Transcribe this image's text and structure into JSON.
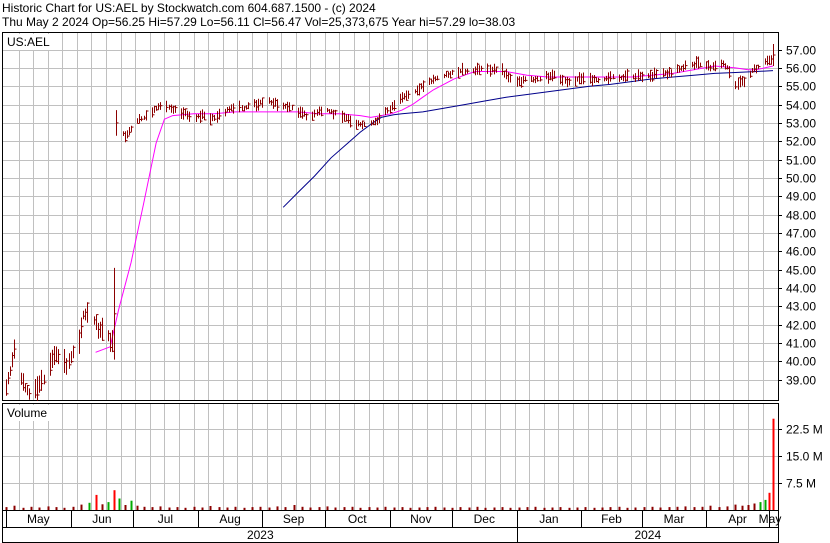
{
  "header": {
    "line1": "Historic Chart for US:AEL by Stockwatch.com 604.687.1500 - (c) 2024",
    "line2": "Thu May  2 2024  Op=56.25  Hi=57.29  Lo=56.11  Cl=56.47  Vol=25,373,675  Year hi=57.29  lo=38.03"
  },
  "chart_data": [
    {
      "type": "line",
      "title": "US:AEL",
      "ylim": [
        37.9,
        57.9
      ],
      "y_ticks": [
        "39.00",
        "40.00",
        "41.00",
        "42.00",
        "43.00",
        "44.00",
        "45.00",
        "46.00",
        "47.00",
        "48.00",
        "49.00",
        "50.00",
        "51.00",
        "52.00",
        "53.00",
        "54.00",
        "55.00",
        "56.00",
        "57.00"
      ],
      "x_month_labels": [
        "May",
        "Jun",
        "Jul",
        "Aug",
        "Sep",
        "Oct",
        "Nov",
        "Dec",
        "Jan",
        "Feb",
        "Mar",
        "Apr",
        "May"
      ],
      "x_year_labels": [
        "2023",
        "2024"
      ],
      "x_range_days": [
        0,
        368
      ],
      "grid": true,
      "colors": {
        "bars": "#8b0000",
        "ma_short": "#ff00ff",
        "ma_long": "#00008b",
        "grid": "#c0c0c0"
      },
      "price_path": [
        [
          0,
          38.6
        ],
        [
          4,
          40.5
        ],
        [
          7,
          39.1
        ],
        [
          11,
          38.2
        ],
        [
          15,
          38.5
        ],
        [
          19,
          39.3
        ],
        [
          22,
          40.1
        ],
        [
          26,
          40.4
        ],
        [
          29,
          39.7
        ],
        [
          32,
          40.6
        ],
        [
          35,
          41.3
        ],
        [
          37,
          42.5
        ],
        [
          40,
          42.6
        ],
        [
          42,
          42.2
        ],
        [
          45,
          41.6
        ],
        [
          48,
          41.7
        ],
        [
          50,
          41.2
        ],
        [
          52,
          40.7
        ],
        [
          53,
          52.9
        ],
        [
          55,
          52.4
        ],
        [
          58,
          52.3
        ],
        [
          62,
          53.0
        ],
        [
          66,
          53.3
        ],
        [
          70,
          53.6
        ],
        [
          74,
          53.9
        ],
        [
          78,
          53.9
        ],
        [
          82,
          53.7
        ],
        [
          86,
          53.5
        ],
        [
          90,
          53.3
        ],
        [
          94,
          53.4
        ],
        [
          98,
          53.2
        ],
        [
          102,
          53.4
        ],
        [
          106,
          53.7
        ],
        [
          110,
          53.8
        ],
        [
          114,
          53.8
        ],
        [
          118,
          54.0
        ],
        [
          122,
          54.1
        ],
        [
          126,
          54.2
        ],
        [
          130,
          54.0
        ],
        [
          134,
          53.9
        ],
        [
          138,
          53.8
        ],
        [
          142,
          53.5
        ],
        [
          146,
          53.3
        ],
        [
          150,
          53.6
        ],
        [
          154,
          53.7
        ],
        [
          158,
          53.5
        ],
        [
          162,
          53.4
        ],
        [
          166,
          53.0
        ],
        [
          170,
          52.9
        ],
        [
          174,
          52.9
        ],
        [
          178,
          53.1
        ],
        [
          182,
          53.6
        ],
        [
          186,
          54.0
        ],
        [
          190,
          54.3
        ],
        [
          194,
          54.6
        ],
        [
          198,
          54.9
        ],
        [
          202,
          55.2
        ],
        [
          206,
          55.4
        ],
        [
          210,
          55.6
        ],
        [
          214,
          55.7
        ],
        [
          218,
          55.8
        ],
        [
          222,
          55.8
        ],
        [
          226,
          55.9
        ],
        [
          230,
          56.0
        ],
        [
          234,
          55.9
        ],
        [
          238,
          55.8
        ],
        [
          242,
          55.4
        ],
        [
          246,
          55.3
        ],
        [
          250,
          55.4
        ],
        [
          254,
          55.3
        ],
        [
          258,
          55.5
        ],
        [
          262,
          55.6
        ],
        [
          266,
          55.4
        ],
        [
          270,
          55.3
        ],
        [
          274,
          55.4
        ],
        [
          278,
          55.3
        ],
        [
          282,
          55.4
        ],
        [
          286,
          55.3
        ],
        [
          290,
          55.5
        ],
        [
          294,
          55.4
        ],
        [
          298,
          55.5
        ],
        [
          302,
          55.5
        ],
        [
          306,
          55.6
        ],
        [
          310,
          55.6
        ],
        [
          314,
          55.7
        ],
        [
          318,
          55.7
        ],
        [
          322,
          55.9
        ],
        [
          326,
          56.1
        ],
        [
          330,
          56.2
        ],
        [
          334,
          56.2
        ],
        [
          338,
          56.0
        ],
        [
          340,
          56.1
        ],
        [
          342,
          56.3
        ],
        [
          344,
          56.2
        ],
        [
          346,
          56.0
        ],
        [
          348,
          55.5
        ],
        [
          350,
          55.1
        ],
        [
          353,
          55.2
        ],
        [
          356,
          55.4
        ],
        [
          358,
          55.9
        ],
        [
          360,
          56.0
        ],
        [
          362,
          56.1
        ],
        [
          364,
          56.3
        ],
        [
          366,
          56.5
        ],
        [
          368,
          56.5
        ]
      ],
      "special_bars": [
        {
          "x": 52,
          "low": 40.1,
          "high": 45.1
        },
        {
          "x": 53,
          "low": 52.3,
          "high": 53.7
        },
        {
          "x": 368,
          "low": 56.1,
          "high": 57.3
        }
      ],
      "ma_short": [
        [
          43,
          40.5
        ],
        [
          50,
          40.8
        ],
        [
          54,
          42.8
        ],
        [
          60,
          45.4
        ],
        [
          66,
          48.6
        ],
        [
          72,
          51.9
        ],
        [
          76,
          53.2
        ],
        [
          80,
          53.4
        ],
        [
          90,
          53.5
        ],
        [
          100,
          53.5
        ],
        [
          110,
          53.6
        ],
        [
          120,
          53.6
        ],
        [
          130,
          53.6
        ],
        [
          140,
          53.6
        ],
        [
          150,
          53.5
        ],
        [
          160,
          53.5
        ],
        [
          170,
          53.4
        ],
        [
          175,
          53.3
        ],
        [
          180,
          53.4
        ],
        [
          185,
          53.5
        ],
        [
          190,
          53.7
        ],
        [
          195,
          54.0
        ],
        [
          200,
          54.4
        ],
        [
          205,
          54.8
        ],
        [
          210,
          55.1
        ],
        [
          215,
          55.4
        ],
        [
          220,
          55.6
        ],
        [
          225,
          55.8
        ],
        [
          230,
          55.8
        ],
        [
          235,
          55.8
        ],
        [
          240,
          55.8
        ],
        [
          245,
          55.7
        ],
        [
          250,
          55.6
        ],
        [
          260,
          55.5
        ],
        [
          270,
          55.5
        ],
        [
          280,
          55.5
        ],
        [
          290,
          55.5
        ],
        [
          300,
          55.5
        ],
        [
          310,
          55.6
        ],
        [
          320,
          55.7
        ],
        [
          330,
          55.9
        ],
        [
          340,
          56.1
        ],
        [
          350,
          56.0
        ],
        [
          356,
          55.9
        ],
        [
          360,
          55.9
        ],
        [
          364,
          56.0
        ],
        [
          368,
          56.1
        ]
      ],
      "ma_long": [
        [
          133,
          48.4
        ],
        [
          140,
          49.2
        ],
        [
          148,
          50.1
        ],
        [
          156,
          51.1
        ],
        [
          164,
          51.9
        ],
        [
          170,
          52.5
        ],
        [
          176,
          53.0
        ],
        [
          180,
          53.3
        ],
        [
          186,
          53.45
        ],
        [
          190,
          53.5
        ],
        [
          200,
          53.6
        ],
        [
          210,
          53.8
        ],
        [
          220,
          54.0
        ],
        [
          230,
          54.2
        ],
        [
          240,
          54.4
        ],
        [
          250,
          54.55
        ],
        [
          260,
          54.7
        ],
        [
          270,
          54.85
        ],
        [
          280,
          55.0
        ],
        [
          290,
          55.1
        ],
        [
          300,
          55.25
        ],
        [
          310,
          55.4
        ],
        [
          320,
          55.5
        ],
        [
          330,
          55.6
        ],
        [
          340,
          55.7
        ],
        [
          350,
          55.75
        ],
        [
          360,
          55.8
        ],
        [
          368,
          55.85
        ]
      ]
    },
    {
      "type": "bar",
      "title": "Volume",
      "ylim": [
        0,
        29.5
      ],
      "y_ticks": [
        "7.5 M",
        "15.0 M",
        "22.5 M"
      ],
      "bars": [
        [
          0,
          0.8
        ],
        [
          4,
          1.2
        ],
        [
          8,
          0.6
        ],
        [
          12,
          0.9
        ],
        [
          16,
          0.7
        ],
        [
          20,
          1.0
        ],
        [
          24,
          0.8
        ],
        [
          28,
          0.6
        ],
        [
          32,
          0.9
        ],
        [
          36,
          1.5
        ],
        [
          40,
          2.0
        ],
        [
          43,
          4.2
        ],
        [
          46,
          1.6
        ],
        [
          49,
          2.2
        ],
        [
          52,
          5.5
        ],
        [
          54,
          3.2
        ],
        [
          57,
          1.4
        ],
        [
          60,
          2.6
        ],
        [
          63,
          1.2
        ],
        [
          66,
          0.9
        ],
        [
          70,
          0.8
        ],
        [
          74,
          1.0
        ],
        [
          78,
          0.7
        ],
        [
          82,
          0.8
        ],
        [
          86,
          0.6
        ],
        [
          90,
          0.9
        ],
        [
          94,
          0.7
        ],
        [
          98,
          1.1
        ],
        [
          102,
          0.8
        ],
        [
          106,
          0.7
        ],
        [
          110,
          0.9
        ],
        [
          114,
          0.6
        ],
        [
          118,
          0.8
        ],
        [
          122,
          0.9
        ],
        [
          126,
          0.7
        ],
        [
          130,
          1.0
        ],
        [
          134,
          0.8
        ],
        [
          138,
          1.4
        ],
        [
          142,
          0.9
        ],
        [
          146,
          0.7
        ],
        [
          150,
          0.8
        ],
        [
          154,
          1.0
        ],
        [
          158,
          0.7
        ],
        [
          162,
          0.8
        ],
        [
          166,
          0.9
        ],
        [
          170,
          0.6
        ],
        [
          174,
          0.8
        ],
        [
          178,
          0.7
        ],
        [
          182,
          0.9
        ],
        [
          186,
          0.7
        ],
        [
          190,
          0.8
        ],
        [
          194,
          0.6
        ],
        [
          198,
          0.7
        ],
        [
          202,
          0.8
        ],
        [
          206,
          0.9
        ],
        [
          210,
          0.7
        ],
        [
          214,
          0.6
        ],
        [
          218,
          0.8
        ],
        [
          222,
          0.7
        ],
        [
          226,
          0.9
        ],
        [
          230,
          0.6
        ],
        [
          234,
          0.7
        ],
        [
          238,
          0.8
        ],
        [
          242,
          0.6
        ],
        [
          246,
          0.7
        ],
        [
          250,
          0.8
        ],
        [
          254,
          0.9
        ],
        [
          258,
          0.6
        ],
        [
          262,
          0.7
        ],
        [
          266,
          0.8
        ],
        [
          270,
          0.6
        ],
        [
          274,
          0.7
        ],
        [
          278,
          0.8
        ],
        [
          282,
          0.6
        ],
        [
          286,
          0.7
        ],
        [
          290,
          0.8
        ],
        [
          294,
          0.9
        ],
        [
          298,
          0.6
        ],
        [
          302,
          0.7
        ],
        [
          306,
          0.8
        ],
        [
          310,
          0.9
        ],
        [
          314,
          0.7
        ],
        [
          318,
          0.8
        ],
        [
          322,
          0.9
        ],
        [
          326,
          1.0
        ],
        [
          330,
          0.8
        ],
        [
          334,
          0.9
        ],
        [
          338,
          1.2
        ],
        [
          342,
          0.8
        ],
        [
          346,
          1.0
        ],
        [
          350,
          1.5
        ],
        [
          353,
          1.2
        ],
        [
          356,
          1.4
        ],
        [
          359,
          1.8
        ],
        [
          362,
          2.2
        ],
        [
          364,
          2.8
        ],
        [
          366,
          4.8
        ],
        [
          368,
          25.4
        ]
      ]
    }
  ]
}
